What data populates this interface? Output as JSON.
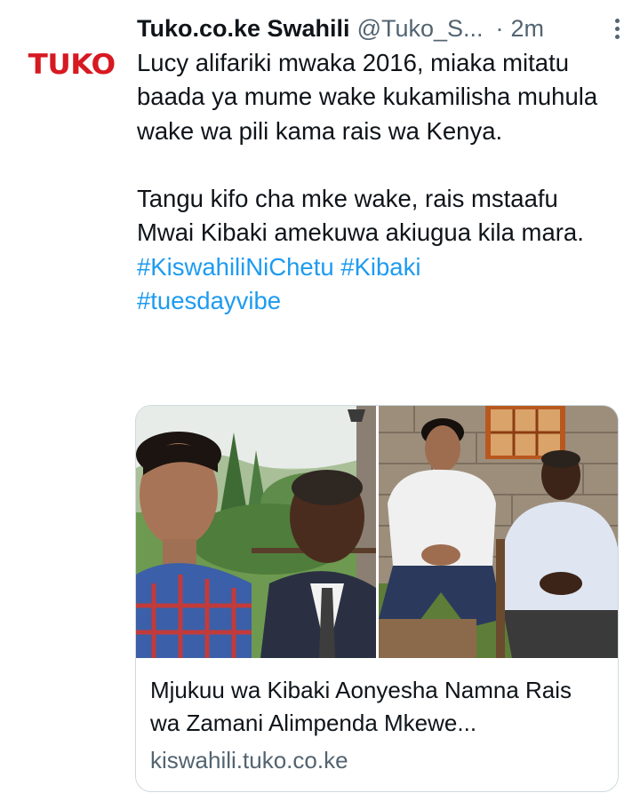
{
  "tweet": {
    "avatar_text": "TUKO",
    "author_name": "Tuko.co.ke Swahili",
    "handle": "@Tuko_S...",
    "separator": "·",
    "time": "2m",
    "paragraph1": "Lucy alifariki mwaka 2016, miaka mitatu baada ya mume wake kukamilisha muhula wake wa pili kama rais wa Kenya.",
    "paragraph2": "Tangu kifo cha mke wake, rais mstaafu Mwai Kibaki amekuwa akiugua kila mara.",
    "hashtags": [
      "#KiswahiliNiChetu",
      "#Kibaki",
      "#tuesdayvibe"
    ]
  },
  "card": {
    "title": "Mjukuu wa Kibaki Aonyesha Namna Rais wa Zamani Alimpenda Mkewe...",
    "domain": "kiswahili.tuko.co.ke"
  },
  "colors": {
    "brand_red": "#d71921",
    "link_blue": "#1d9bf0",
    "secondary_text": "#536471"
  }
}
